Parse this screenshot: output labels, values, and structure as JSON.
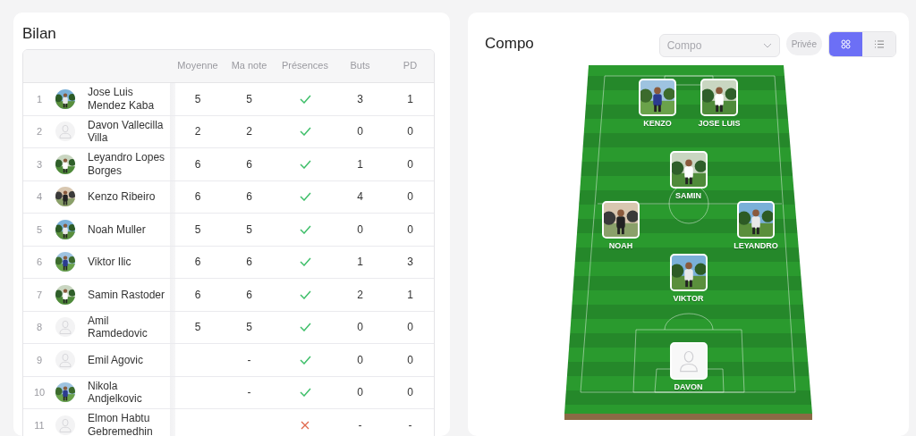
{
  "bilan": {
    "title": "Bilan",
    "columns": [
      "Moyenne",
      "Ma note",
      "Présences",
      "Buts",
      "PD"
    ],
    "rows": [
      {
        "rank": "1",
        "name": "Jose Luis Mendez Kaba",
        "photo": true,
        "moyenne": "5",
        "note": "5",
        "present": true,
        "buts": "3",
        "pd": "1"
      },
      {
        "rank": "2",
        "name": "Davon Vallecilla Villa",
        "photo": false,
        "moyenne": "2",
        "note": "2",
        "present": true,
        "buts": "0",
        "pd": "0"
      },
      {
        "rank": "3",
        "name": "Leyandro Lopes Borges",
        "photo": true,
        "moyenne": "6",
        "note": "6",
        "present": true,
        "buts": "1",
        "pd": "0"
      },
      {
        "rank": "4",
        "name": "Kenzo Ribeiro",
        "photo": true,
        "moyenne": "6",
        "note": "6",
        "present": true,
        "buts": "4",
        "pd": "0"
      },
      {
        "rank": "5",
        "name": "Noah Muller",
        "photo": true,
        "moyenne": "5",
        "note": "5",
        "present": true,
        "buts": "0",
        "pd": "0"
      },
      {
        "rank": "6",
        "name": "Viktor Ilic",
        "photo": true,
        "moyenne": "6",
        "note": "6",
        "present": true,
        "buts": "1",
        "pd": "3"
      },
      {
        "rank": "7",
        "name": "Samin Rastoder",
        "photo": true,
        "moyenne": "6",
        "note": "6",
        "present": true,
        "buts": "2",
        "pd": "1"
      },
      {
        "rank": "8",
        "name": "Amil Ramdedovic",
        "photo": false,
        "moyenne": "5",
        "note": "5",
        "present": true,
        "buts": "0",
        "pd": "0"
      },
      {
        "rank": "9",
        "name": "Emil Agovic",
        "photo": false,
        "note": "-",
        "present": true,
        "buts": "0",
        "pd": "0"
      },
      {
        "rank": "10",
        "name": "Nikola Andjelkovic",
        "photo": true,
        "note": "-",
        "present": true,
        "buts": "0",
        "pd": "0"
      },
      {
        "rank": "11",
        "name": "Elmon Habtu Gebremedhin",
        "photo": false,
        "present": false,
        "buts": "-",
        "pd": "-"
      }
    ]
  },
  "compo": {
    "title": "Compo",
    "select": {
      "placeholder": "Compo"
    },
    "privacy": "Privée",
    "views": [
      {
        "kind": "grid",
        "selected": true
      },
      {
        "kind": "list",
        "selected": false
      }
    ],
    "lines": [
      [
        {
          "name": "KENZO",
          "photo": true
        },
        {
          "name": "JOSE LUIS",
          "photo": true
        }
      ],
      [
        {
          "name": "SAMIN",
          "photo": true
        }
      ],
      [
        {
          "name": "NOAH",
          "photo": true
        },
        {
          "name": "LEYANDRO",
          "photo": true
        }
      ],
      [
        {
          "name": "VIKTOR",
          "photo": true
        }
      ],
      [
        {
          "name": "DAVON",
          "photo": false
        }
      ]
    ]
  }
}
